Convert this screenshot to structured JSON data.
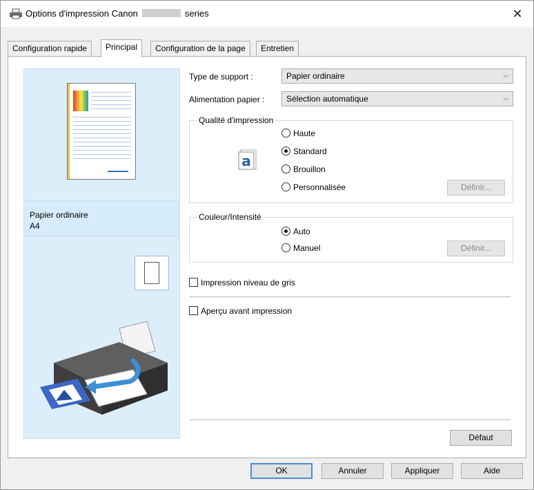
{
  "window": {
    "title_prefix": "Options d'impression Canon",
    "title_suffix": "series",
    "close_glyph": "✕"
  },
  "tabs": [
    {
      "label": "Configuration rapide",
      "active": false
    },
    {
      "label": "Principal",
      "active": true
    },
    {
      "label": "Configuration de la page",
      "active": false
    },
    {
      "label": "Entretien",
      "active": false
    }
  ],
  "preview": {
    "media_line1": "Papier ordinaire",
    "media_line2": "A4"
  },
  "form": {
    "media_type_label": "Type de support :",
    "media_type_value": "Papier ordinaire",
    "paper_source_label": "Alimentation papier :",
    "paper_source_value": "Sélection automatique",
    "quality_group": "Qualité d'impression",
    "quality_options": [
      "Haute",
      "Standard",
      "Brouillon",
      "Personnalisée"
    ],
    "quality_selected": "Standard",
    "quality_define": "Définir...",
    "color_group": "Couleur/Intensité",
    "color_options": [
      "Auto",
      "Manuel"
    ],
    "color_selected": "Auto",
    "color_define": "Définir...",
    "grayscale_label": "Impression niveau de gris",
    "grayscale_checked": false,
    "preview_label": "Aperçu avant impression",
    "preview_checked": false,
    "default_button": "Défaut"
  },
  "footer": {
    "ok": "OK",
    "cancel": "Annuler",
    "apply": "Appliquer",
    "help": "Aide"
  },
  "icons": {
    "title": "printer-icon",
    "quality": "letter-a-icon",
    "orientation": "portrait-page-icon",
    "printer": "printer-illustration"
  }
}
